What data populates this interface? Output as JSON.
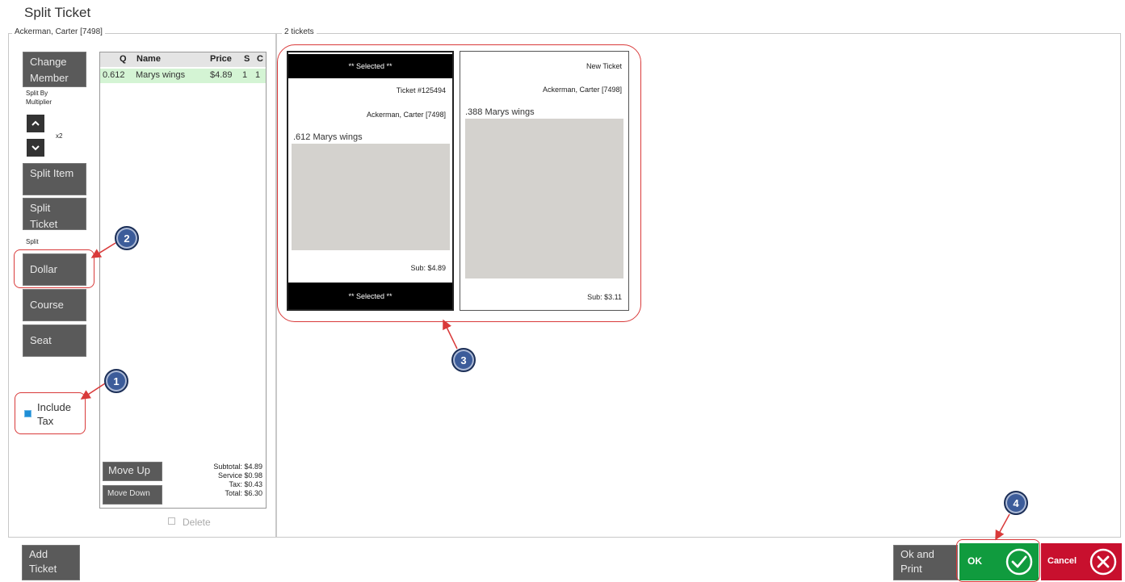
{
  "window": {
    "title": "Split Ticket"
  },
  "left_group": {
    "legend": "Ackerman, Carter [7498]",
    "change_member": "Change Member",
    "split_by_multiplier": "Split By Multiplier",
    "multiplier_value": "x2",
    "split_item": "Split Item",
    "split_ticket": "Split Ticket",
    "split_label": "Split",
    "dollar": "Dollar",
    "course": "Course",
    "seat": "Seat",
    "include_tax": {
      "label": "Include Tax",
      "checked": true
    }
  },
  "items": {
    "columns": [
      "Q",
      "Name",
      "Price",
      "S",
      "C"
    ],
    "rows": [
      {
        "q": "0.612",
        "name": "Marys wings",
        "price": "$4.89",
        "s": "1",
        "c": "1"
      }
    ],
    "move_up": "Move Up",
    "move_down": "Move Down",
    "totals": {
      "subtotal_label": "Subtotal:",
      "subtotal": "$4.89",
      "service_label": "Service",
      "service": "$0.98",
      "tax_label": "Tax:",
      "tax": "$0.43",
      "total_label": "Total:",
      "total": "$6.30"
    },
    "delete": "Delete"
  },
  "tickets_group": {
    "legend": "2 tickets",
    "tickets": [
      {
        "selected_banner": "** Selected **",
        "number": "Ticket #125494",
        "member": "Ackerman, Carter [7498]",
        "item": ".612  Marys wings",
        "sub": "Sub: $4.89"
      },
      {
        "header": "New Ticket",
        "member": "Ackerman, Carter [7498]",
        "item": ".388  Marys wings",
        "sub": "Sub: $3.11"
      }
    ]
  },
  "bottom": {
    "add_ticket": "Add Ticket",
    "ok_and_print": "Ok and Print",
    "ok": "OK",
    "cancel": "Cancel"
  },
  "annotations": {
    "badges": [
      "1",
      "2",
      "3",
      "4"
    ]
  },
  "colors": {
    "ok": "#109b3e",
    "cancel": "#c8102e",
    "annotation": "#d93a3a",
    "badge": "#3c5c9a",
    "selected_row": "#d4f4d4"
  }
}
